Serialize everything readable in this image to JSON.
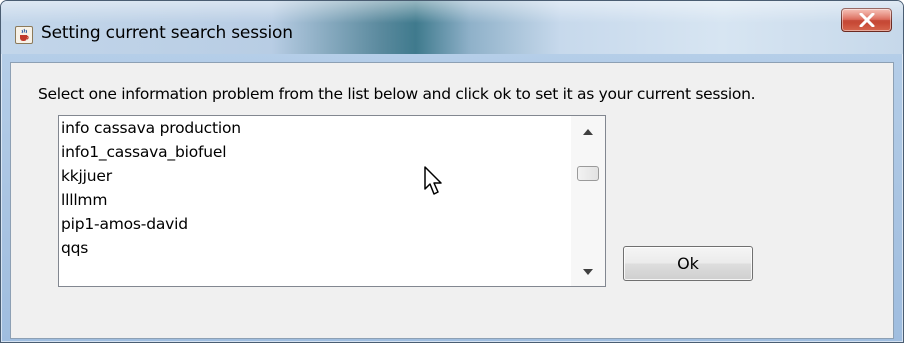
{
  "window": {
    "title": "Setting current search session",
    "app_icon": "java-cup-icon",
    "close_icon": "close-icon"
  },
  "dialog": {
    "instruction": "Select one information problem from the list below and click ok to set it as your current session.",
    "list_items": [
      "info cassava production",
      "info1_cassava_biofuel",
      "kkjjuer",
      "llllmm",
      "pip1-amos-david",
      "qqs"
    ],
    "ok_label": "Ok"
  },
  "colors": {
    "close_button": "#c9453a",
    "panel_background": "#f0f0f0",
    "window_frame": "#b9d1ea"
  }
}
